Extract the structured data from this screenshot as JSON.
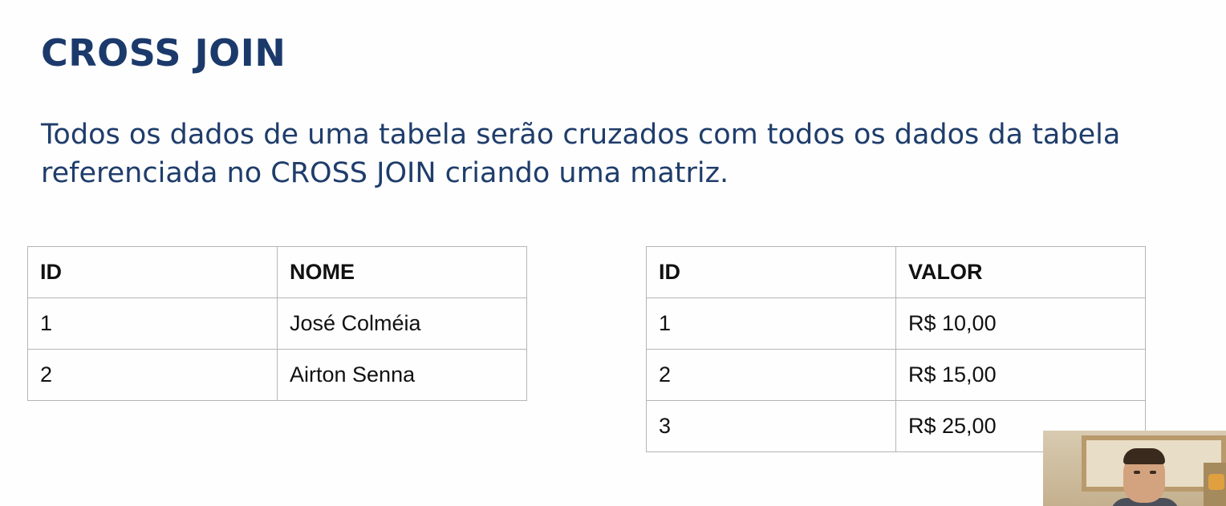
{
  "slide": {
    "title": "CROSS JOIN",
    "subtitle": "Todos os dados de uma tabela serão cruzados com todos os dados da tabela referenciada no CROSS JOIN criando uma matriz."
  },
  "table_left": {
    "headers": [
      "ID",
      "NOME"
    ],
    "rows": [
      [
        "1",
        "José Colméia"
      ],
      [
        "2",
        "Airton Senna"
      ]
    ]
  },
  "table_right": {
    "headers": [
      "ID",
      "VALOR"
    ],
    "rows": [
      [
        "1",
        "R$ 10,00"
      ],
      [
        "2",
        "R$ 15,00"
      ],
      [
        "3",
        "R$ 25,00"
      ]
    ]
  },
  "colors": {
    "title": "#1b3a6b",
    "subtitle": "#1f3d6b",
    "table_border": "#b5b5b5"
  },
  "webcam": {
    "content": "presenter-video"
  }
}
